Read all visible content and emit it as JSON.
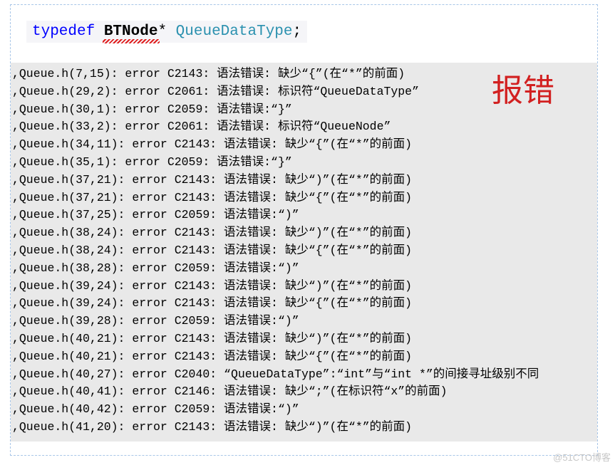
{
  "code": {
    "typedef": "typedef",
    "btnode": "BTNode",
    "star": "*",
    "type": "QueueDataType",
    "semicolon": ";"
  },
  "error_label": "报错",
  "watermark": "@51CTO博客",
  "errors": [
    ",Queue.h(7,15): error C2143: 语法错误: 缺少“{”(在“*”的前面)",
    ",Queue.h(29,2): error C2061: 语法错误: 标识符“QueueDataType”",
    ",Queue.h(30,1): error C2059: 语法错误:“}”",
    ",Queue.h(33,2): error C2061: 语法错误: 标识符“QueueNode”",
    ",Queue.h(34,11): error C2143: 语法错误: 缺少“{”(在“*”的前面)",
    ",Queue.h(35,1): error C2059: 语法错误:“}”",
    ",Queue.h(37,21): error C2143: 语法错误: 缺少“)”(在“*”的前面)",
    ",Queue.h(37,21): error C2143: 语法错误: 缺少“{”(在“*”的前面)",
    ",Queue.h(37,25): error C2059: 语法错误:“)”",
    ",Queue.h(38,24): error C2143: 语法错误: 缺少“)”(在“*”的前面)",
    ",Queue.h(38,24): error C2143: 语法错误: 缺少“{”(在“*”的前面)",
    ",Queue.h(38,28): error C2059: 语法错误:“)”",
    ",Queue.h(39,24): error C2143: 语法错误: 缺少“)”(在“*”的前面)",
    ",Queue.h(39,24): error C2143: 语法错误: 缺少“{”(在“*”的前面)",
    ",Queue.h(39,28): error C2059: 语法错误:“)”",
    ",Queue.h(40,21): error C2143: 语法错误: 缺少“)”(在“*”的前面)",
    ",Queue.h(40,21): error C2143: 语法错误: 缺少“{”(在“*”的前面)",
    ",Queue.h(40,27): error C2040: “QueueDataType”:“int”与“int *”的间接寻址级别不同",
    ",Queue.h(40,41): error C2146: 语法错误: 缺少“;”(在标识符“x”的前面)",
    ",Queue.h(40,42): error C2059: 语法错误:“)”",
    ",Queue.h(41,20): error C2143: 语法错误: 缺少“)”(在“*”的前面)"
  ]
}
